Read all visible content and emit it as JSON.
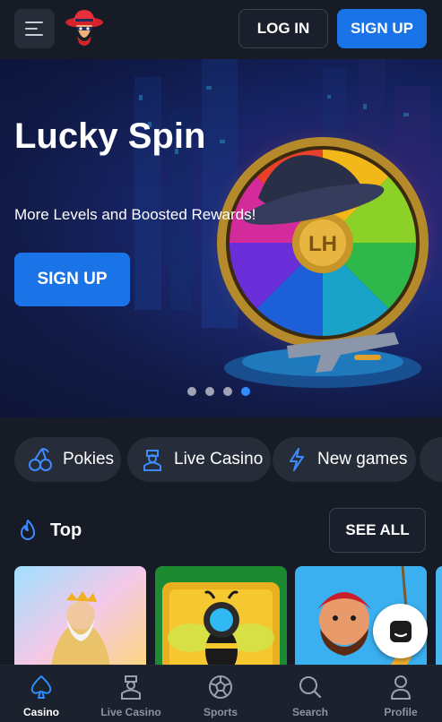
{
  "header": {
    "menu_icon": "hamburger-icon",
    "logo": "cowboy-mascot-logo",
    "login_label": "LOG IN",
    "signup_label": "SIGN UP"
  },
  "hero": {
    "title": "Lucky Spin",
    "subtitle": "More Levels and Boosted Rewards!",
    "cta_label": "SIGN UP",
    "slides_total": 4,
    "slide_active": 4,
    "wheel_emblem": "LH"
  },
  "categories": [
    {
      "label": "Pokies",
      "icon": "cherries-icon"
    },
    {
      "label": "Live Casino",
      "icon": "dealer-icon"
    },
    {
      "label": "New games",
      "icon": "lightning-icon"
    }
  ],
  "top_section": {
    "title": "Top",
    "icon": "flame-icon",
    "see_all_label": "SEE ALL"
  },
  "bottom_nav": [
    {
      "label": "Casino",
      "icon": "spade-icon",
      "active": true
    },
    {
      "label": "Live Casino",
      "icon": "dealer-icon",
      "active": false
    },
    {
      "label": "Sports",
      "icon": "soccer-ball-icon",
      "active": false
    },
    {
      "label": "Search",
      "icon": "search-icon",
      "active": false
    },
    {
      "label": "Profile",
      "icon": "person-icon",
      "active": false
    }
  ],
  "colors": {
    "background": "#161b26",
    "surface": "#262c38",
    "accent": "#1a74e8",
    "nav_active": "#2f8dff"
  }
}
